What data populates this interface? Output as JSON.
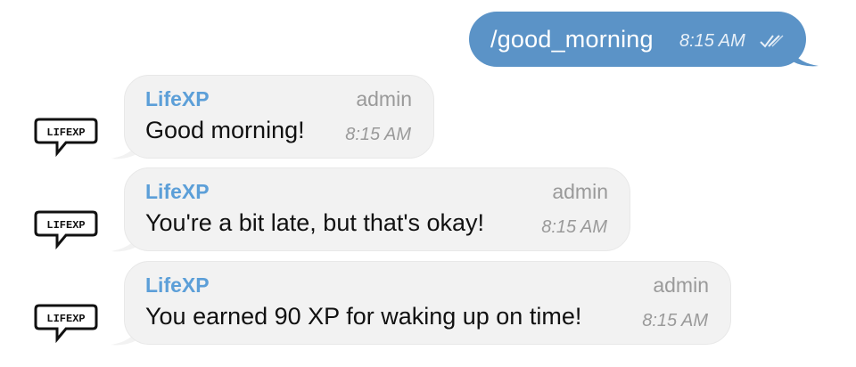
{
  "outgoing": {
    "text": "/good_morning",
    "time": "8:15 AM",
    "status_icon": "double-check-icon",
    "color": "#5b93c7"
  },
  "incoming": [
    {
      "sender": "LifeXP",
      "role": "admin",
      "text": "Good morning!",
      "time": "8:15 AM",
      "avatar_label": "LIFEXP"
    },
    {
      "sender": "LifeXP",
      "role": "admin",
      "text": "You're a bit late, but that's okay!",
      "time": "8:15 AM",
      "avatar_label": "LIFEXP"
    },
    {
      "sender": "LifeXP",
      "role": "admin",
      "text": "You earned 90 XP for waking up on time!",
      "time": "8:15 AM",
      "avatar_label": "LIFEXP"
    }
  ],
  "colors": {
    "sender_name": "#5c9fd8",
    "incoming_bubble": "#f2f2f2",
    "meta_text": "#9a9a9a"
  }
}
